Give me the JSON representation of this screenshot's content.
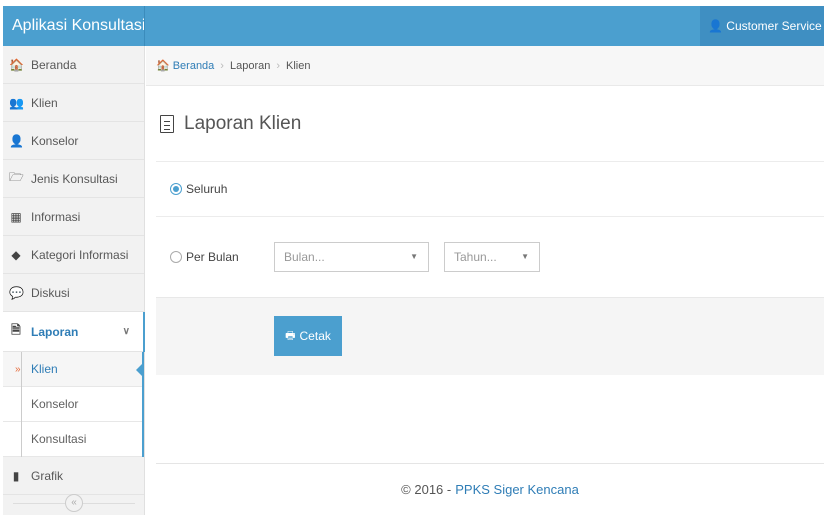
{
  "app": {
    "brand": "Aplikasi Konsultasi",
    "user_label": "Customer Service"
  },
  "sidebar": {
    "items": [
      {
        "label": "Beranda",
        "icon": "home-icon"
      },
      {
        "label": "Klien",
        "icon": "users-icon"
      },
      {
        "label": "Konselor",
        "icon": "user-icon"
      },
      {
        "label": "Jenis Konsultasi",
        "icon": "folder-icon"
      },
      {
        "label": "Informasi",
        "icon": "grid-icon"
      },
      {
        "label": "Kategori Informasi",
        "icon": "tag-icon"
      },
      {
        "label": "Diskusi",
        "icon": "comments-icon"
      },
      {
        "label": "Laporan",
        "icon": "file-text-icon"
      }
    ],
    "laporan_sub": [
      {
        "label": "Klien"
      },
      {
        "label": "Konselor"
      },
      {
        "label": "Konsultasi"
      }
    ],
    "grafik": {
      "label": "Grafik",
      "icon": "bar-chart-icon"
    }
  },
  "breadcrumb": {
    "home": "Beranda",
    "level2": "Laporan",
    "current": "Klien"
  },
  "page": {
    "title": "Laporan Klien"
  },
  "form": {
    "option_all": "Seluruh",
    "option_month": "Per Bulan",
    "month_placeholder": "Bulan...",
    "year_placeholder": "Tahun...",
    "print_label": "Cetak",
    "selected_option": "Seluruh"
  },
  "footer": {
    "copyright": "© 2016 -",
    "org": "PPKS Siger Kencana"
  },
  "colors": {
    "accent": "#4b9fcf",
    "link": "#2f7db6",
    "bullet": "#e66b3b"
  }
}
